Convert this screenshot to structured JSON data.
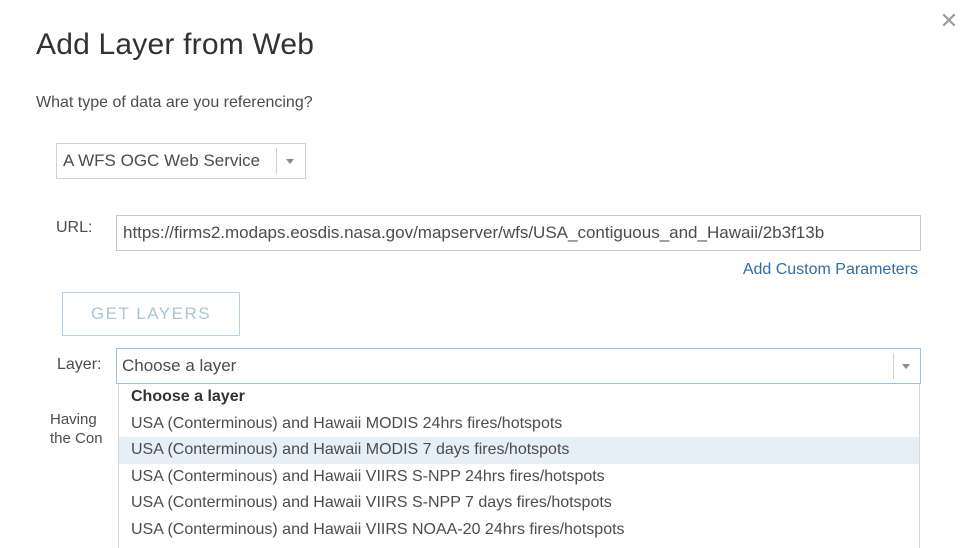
{
  "dialog": {
    "title": "Add Layer from Web",
    "close_icon": "close-icon"
  },
  "data_type": {
    "question": "What type of data are you referencing?",
    "selected": "A WFS OGC Web Service"
  },
  "url": {
    "label": "URL:",
    "value": "https://firms2.modaps.eosdis.nasa.gov/mapserver/wfs/USA_contiguous_and_Hawaii/2b3f13b",
    "custom_params_link": "Add Custom Parameters"
  },
  "get_layers_button": "GET LAYERS",
  "layer": {
    "label": "Layer:",
    "selected": "Choose a layer",
    "options": [
      "Choose a layer",
      "USA (Conterminous) and Hawaii MODIS 24hrs fires/hotspots",
      "USA (Conterminous) and Hawaii MODIS 7 days fires/hotspots",
      "USA (Conterminous) and Hawaii VIIRS S-NPP 24hrs fires/hotspots",
      "USA (Conterminous) and Hawaii VIIRS S-NPP 7 days fires/hotspots",
      "USA (Conterminous) and Hawaii VIIRS NOAA-20 24hrs fires/hotspots"
    ],
    "highlighted_index": 2
  },
  "partially_hidden_text": {
    "line1": "Having",
    "line2": "the Con"
  },
  "colors": {
    "link": "#2f6ea7",
    "highlight": "#e6eef6",
    "button_text": "#a9c4dc"
  }
}
